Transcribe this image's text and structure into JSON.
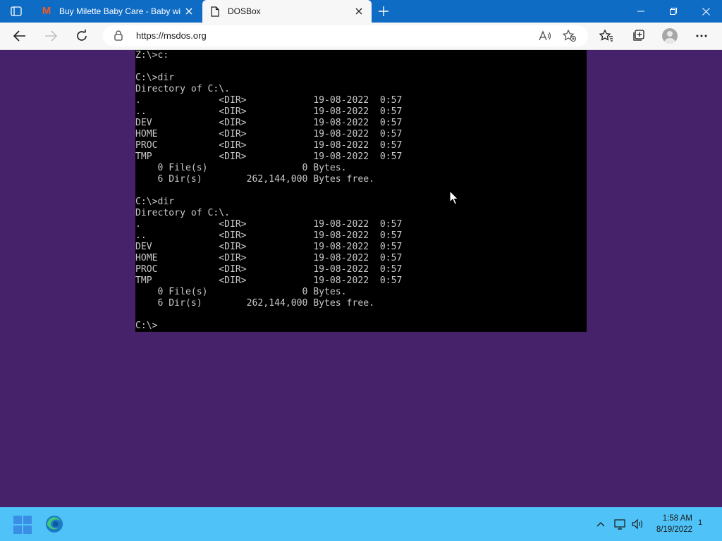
{
  "browser": {
    "tabs": [
      {
        "title": "Buy Milette Baby Care - Baby wipes",
        "favicon": "M"
      },
      {
        "title": "DOSBox"
      }
    ],
    "url": "https://msdos.org"
  },
  "terminal": {
    "lines": [
      "Z:\\>c:",
      "",
      "C:\\>dir",
      "Directory of C:\\.",
      ".              <DIR>            19-08-2022  0:57",
      "..             <DIR>            19-08-2022  0:57",
      "DEV            <DIR>            19-08-2022  0:57",
      "HOME           <DIR>            19-08-2022  0:57",
      "PROC           <DIR>            19-08-2022  0:57",
      "TMP            <DIR>            19-08-2022  0:57",
      "    0 File(s)                 0 Bytes.",
      "    6 Dir(s)        262,144,000 Bytes free.",
      "",
      "C:\\>dir",
      "Directory of C:\\.",
      ".              <DIR>            19-08-2022  0:57",
      "..             <DIR>            19-08-2022  0:57",
      "DEV            <DIR>            19-08-2022  0:57",
      "HOME           <DIR>            19-08-2022  0:57",
      "PROC           <DIR>            19-08-2022  0:57",
      "TMP            <DIR>            19-08-2022  0:57",
      "    0 File(s)                 0 Bytes.",
      "    6 Dir(s)        262,144,000 Bytes free.",
      "",
      "C:\\>"
    ]
  },
  "taskbar": {
    "time": "1:58 AM",
    "date": "8/19/2022",
    "notification_count": "1"
  },
  "colors": {
    "page_background": "#45226a",
    "tabbar": "#0f6cc4",
    "taskbar": "#4fc3f7",
    "terminal_text": "#c9c9c9"
  }
}
